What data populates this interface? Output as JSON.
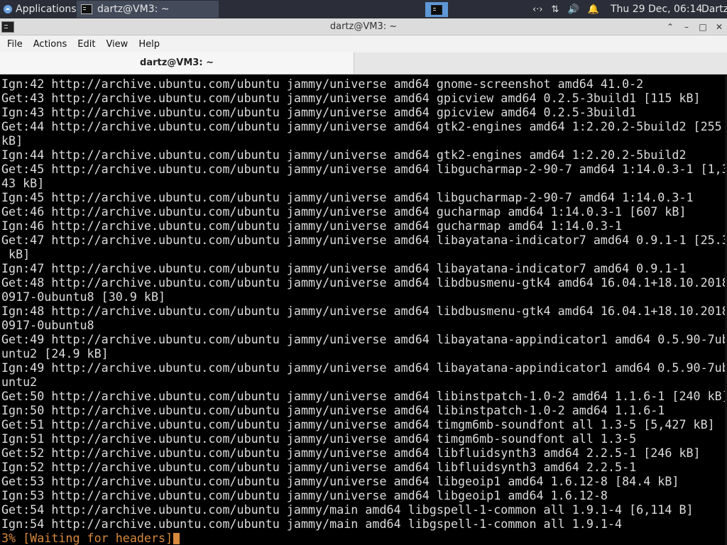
{
  "panel": {
    "apps_label": "Applications",
    "task_label": "dartz@VM3: ~",
    "clock": "Thu 29 Dec, 06:14",
    "user": "Dartz"
  },
  "window": {
    "title": "dartz@VM3: ~",
    "menu": [
      "File",
      "Actions",
      "Edit",
      "View",
      "Help"
    ],
    "tab_label": "dartz@VM3: ~"
  },
  "terminal": {
    "lines": [
      "Ign:42 http://archive.ubuntu.com/ubuntu jammy/universe amd64 gnome-screenshot amd64 41.0-2",
      "Get:43 http://archive.ubuntu.com/ubuntu jammy/universe amd64 gpicview amd64 0.2.5-3build1 [115 kB]",
      "Ign:43 http://archive.ubuntu.com/ubuntu jammy/universe amd64 gpicview amd64 0.2.5-3build1",
      "Get:44 http://archive.ubuntu.com/ubuntu jammy/universe amd64 gtk2-engines amd64 1:2.20.2-5build2 [255",
      "kB]",
      "Ign:44 http://archive.ubuntu.com/ubuntu jammy/universe amd64 gtk2-engines amd64 1:2.20.2-5build2",
      "Get:45 http://archive.ubuntu.com/ubuntu jammy/universe amd64 libgucharmap-2-90-7 amd64 1:14.0.3-1 [1,3",
      "43 kB]",
      "Ign:45 http://archive.ubuntu.com/ubuntu jammy/universe amd64 libgucharmap-2-90-7 amd64 1:14.0.3-1",
      "Get:46 http://archive.ubuntu.com/ubuntu jammy/universe amd64 gucharmap amd64 1:14.0.3-1 [607 kB]",
      "Ign:46 http://archive.ubuntu.com/ubuntu jammy/universe amd64 gucharmap amd64 1:14.0.3-1",
      "Get:47 http://archive.ubuntu.com/ubuntu jammy/universe amd64 libayatana-indicator7 amd64 0.9.1-1 [25.3",
      " kB]",
      "Ign:47 http://archive.ubuntu.com/ubuntu jammy/universe amd64 libayatana-indicator7 amd64 0.9.1-1",
      "Get:48 http://archive.ubuntu.com/ubuntu jammy/universe amd64 libdbusmenu-gtk4 amd64 16.04.1+18.10.2018",
      "0917-0ubuntu8 [30.9 kB]",
      "Ign:48 http://archive.ubuntu.com/ubuntu jammy/universe amd64 libdbusmenu-gtk4 amd64 16.04.1+18.10.2018",
      "0917-0ubuntu8",
      "Get:49 http://archive.ubuntu.com/ubuntu jammy/universe amd64 libayatana-appindicator1 amd64 0.5.90-7ub",
      "untu2 [24.9 kB]",
      "Ign:49 http://archive.ubuntu.com/ubuntu jammy/universe amd64 libayatana-appindicator1 amd64 0.5.90-7ub",
      "untu2",
      "Get:50 http://archive.ubuntu.com/ubuntu jammy/universe amd64 libinstpatch-1.0-2 amd64 1.1.6-1 [240 kB]",
      "Ign:50 http://archive.ubuntu.com/ubuntu jammy/universe amd64 libinstpatch-1.0-2 amd64 1.1.6-1",
      "Get:51 http://archive.ubuntu.com/ubuntu jammy/universe amd64 timgm6mb-soundfont all 1.3-5 [5,427 kB]",
      "Ign:51 http://archive.ubuntu.com/ubuntu jammy/universe amd64 timgm6mb-soundfont all 1.3-5",
      "Get:52 http://archive.ubuntu.com/ubuntu jammy/universe amd64 libfluidsynth3 amd64 2.2.5-1 [246 kB]",
      "Ign:52 http://archive.ubuntu.com/ubuntu jammy/universe amd64 libfluidsynth3 amd64 2.2.5-1",
      "Get:53 http://archive.ubuntu.com/ubuntu jammy/universe amd64 libgeoip1 amd64 1.6.12-8 [84.4 kB]",
      "Ign:53 http://archive.ubuntu.com/ubuntu jammy/universe amd64 libgeoip1 amd64 1.6.12-8",
      "Get:54 http://archive.ubuntu.com/ubuntu jammy/main amd64 libgspell-1-common all 1.9.1-4 [6,114 B]",
      "Ign:54 http://archive.ubuntu.com/ubuntu jammy/main amd64 libgspell-1-common all 1.9.1-4"
    ],
    "status_line": "3% [Waiting for headers]"
  },
  "colors": {
    "panel_bg": "#2b2e38",
    "active_task_bg": "#434a5a",
    "workspace_accent": "#5e97d6",
    "terminal_bg": "#000000",
    "terminal_fg": "#dcdcdc",
    "status_fg": "#d8893e"
  },
  "icons": [
    "applications-menu-icon",
    "terminal-icon",
    "network-icon",
    "updown-arrows-icon",
    "volume-icon",
    "notification-bell-icon",
    "minimize-icon",
    "maximize-icon",
    "close-icon"
  ]
}
